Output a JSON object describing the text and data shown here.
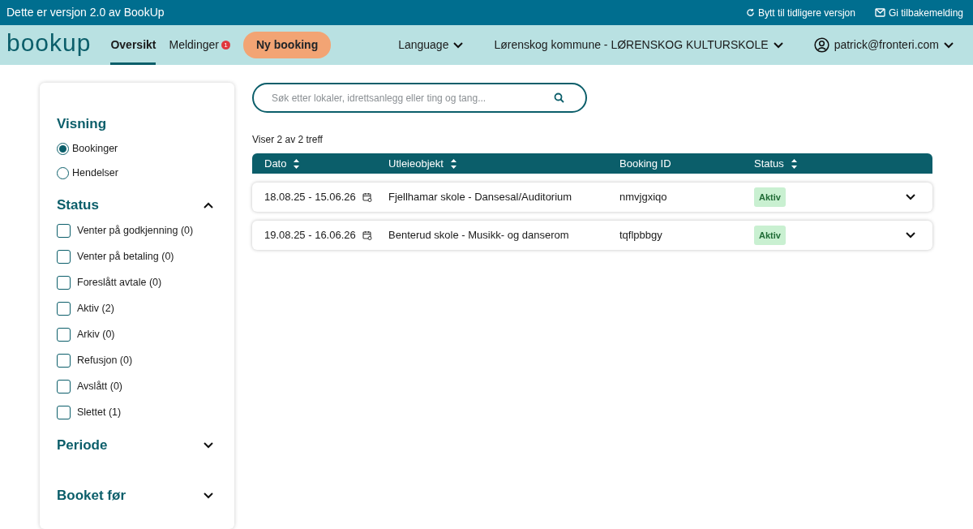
{
  "banner": {
    "text": "Dette er versjon 2.0 av BookUp",
    "links": [
      {
        "kind": "revert",
        "label": "Bytt til tidligere versjon"
      },
      {
        "kind": "feedback",
        "label": "Gi tilbakemelding"
      }
    ]
  },
  "nav": {
    "logo": "bookup",
    "items": [
      {
        "label": "Oversikt",
        "selected": true
      },
      {
        "label": "Meldinger",
        "selected": false,
        "badge": "1"
      }
    ],
    "cta": "Ny booking",
    "language": "Language",
    "organization": "Lørenskog kommune - LØRENSKOG KULTURSKOLE",
    "user": "patrick@fronteri.com"
  },
  "sidebar": {
    "sections": [
      {
        "kind": "radio",
        "title": "Visning",
        "options": [
          {
            "label": "Bookinger",
            "selected": true
          },
          {
            "label": "Hendelser",
            "selected": false
          }
        ]
      },
      {
        "kind": "checkbox",
        "title": "Status",
        "expanded": true,
        "options": [
          {
            "label": "Venter på godkjenning (0)",
            "checked": false
          },
          {
            "label": "Venter på betaling (0)",
            "checked": false
          },
          {
            "label": "Foreslått avtale (0)",
            "checked": false
          },
          {
            "label": "Aktiv (2)",
            "checked": false
          },
          {
            "label": "Arkiv (0)",
            "checked": false
          },
          {
            "label": "Refusjon (0)",
            "checked": false
          },
          {
            "label": "Avslått (0)",
            "checked": false
          },
          {
            "label": "Slettet (1)",
            "checked": false
          }
        ]
      },
      {
        "title": "Periode",
        "expanded": false
      },
      {
        "title": "Booket før",
        "expanded": false
      }
    ]
  },
  "search": {
    "placeholder": "Søk etter lokaler, idrettsanlegg eller ting og tang..."
  },
  "result_count": "Viser 2 av 2 treff",
  "table": {
    "columns": [
      {
        "label": "Dato",
        "sortable": true
      },
      {
        "label": "Utleieobjekt",
        "sortable": true
      },
      {
        "label": "Booking ID",
        "sortable": false
      },
      {
        "label": "Status",
        "sortable": true
      }
    ],
    "rows": [
      {
        "date": "18.08.25 - 15.06.26",
        "object": "Fjellhamar skole - Dansesal/Auditorium",
        "booking_id": "nmvjgxiqo",
        "status": "Aktiv",
        "expanded": false
      },
      {
        "date": "19.08.25 - 16.06.26",
        "object": "Benterud skole - Musikk- og danserom",
        "booking_id": "tqflpbbgy",
        "status": "Aktiv",
        "expanded": false
      }
    ]
  }
}
